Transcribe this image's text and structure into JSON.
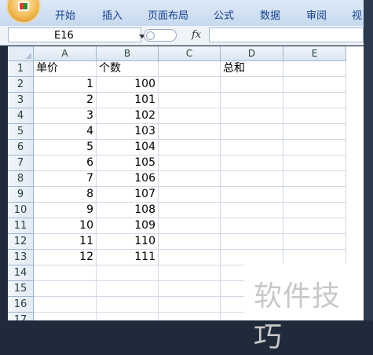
{
  "ribbon": {
    "tabs": [
      "开始",
      "插入",
      "页面布局",
      "公式",
      "数据",
      "审阅",
      "视"
    ]
  },
  "formula_bar": {
    "name_box": "E16",
    "fx_label": "fx",
    "formula": ""
  },
  "sheet": {
    "columns": [
      "A",
      "B",
      "C",
      "D",
      "E"
    ],
    "rows": [
      {
        "n": "1",
        "a": "单价",
        "b": "个数",
        "d": "总和"
      },
      {
        "n": "2",
        "a": "1",
        "b": "100"
      },
      {
        "n": "3",
        "a": "2",
        "b": "101"
      },
      {
        "n": "4",
        "a": "3",
        "b": "102"
      },
      {
        "n": "5",
        "a": "4",
        "b": "103"
      },
      {
        "n": "6",
        "a": "5",
        "b": "104"
      },
      {
        "n": "7",
        "a": "6",
        "b": "105"
      },
      {
        "n": "8",
        "a": "7",
        "b": "106"
      },
      {
        "n": "9",
        "a": "8",
        "b": "107"
      },
      {
        "n": "10",
        "a": "9",
        "b": "108"
      },
      {
        "n": "11",
        "a": "10",
        "b": "109"
      },
      {
        "n": "12",
        "a": "11",
        "b": "110"
      },
      {
        "n": "13",
        "a": "12",
        "b": "111"
      },
      {
        "n": "14"
      },
      {
        "n": "15"
      },
      {
        "n": "16"
      },
      {
        "n": "17"
      }
    ]
  },
  "watermark": "软件技巧"
}
